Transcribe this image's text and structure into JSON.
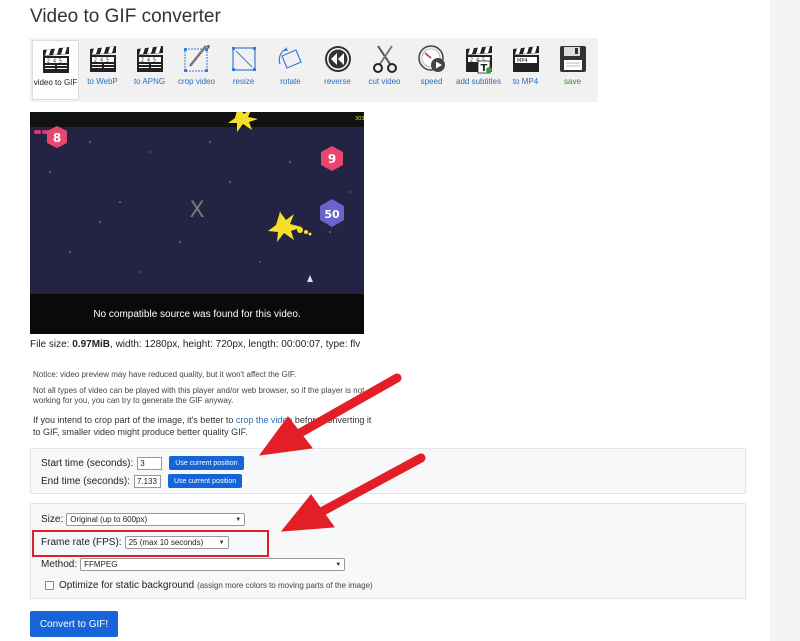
{
  "page": {
    "title": "Video to GIF converter"
  },
  "toolbar": {
    "items": [
      {
        "label": "video to GIF",
        "icon": "clapperboard-icon",
        "active": true
      },
      {
        "label": "to WebP",
        "icon": "clapperboard-icon"
      },
      {
        "label": "to APNG",
        "icon": "clapperboard-icon"
      },
      {
        "label": "crop video",
        "icon": "crop-icon"
      },
      {
        "label": "resize",
        "icon": "resize-icon"
      },
      {
        "label": "rotate",
        "icon": "rotate-icon"
      },
      {
        "label": "reverse",
        "icon": "reverse-icon"
      },
      {
        "label": "cut video",
        "icon": "scissors-icon"
      },
      {
        "label": "speed",
        "icon": "speedometer-icon"
      },
      {
        "label": "add subtitles",
        "icon": "subtitles-icon"
      },
      {
        "label": "to MP4",
        "icon": "mp4-icon"
      },
      {
        "label": "save",
        "icon": "floppy-disk-icon"
      }
    ]
  },
  "video": {
    "message": "No compatible source was found for this video.",
    "close_glyph": "X",
    "game": {
      "badge_8": "8",
      "badge_9": "9",
      "badge_50": "50",
      "score": "303"
    }
  },
  "file_info": {
    "size_label": "File size:",
    "size_value": "0.97MiB",
    "rest": ", width: 1280px, height: 720px, length: 00:00:07, type: flv"
  },
  "notice": {
    "line1": "Notice: video preview may have reduced quality, but it won't affect the GIF.",
    "line2": "Not all types of video can be played with this player and/or web browser, so if the player is not working for you, you can try to generate the GIF anyway.",
    "line3_a": "If you intend to crop part of the image, it's better to ",
    "line3_link": "crop the video",
    "line3_b": " before converting it to GIF, smaller video might produce better quality GIF."
  },
  "time": {
    "start_label": "Start time (seconds):",
    "start_value": "3",
    "end_label": "End time (seconds):",
    "end_value": "7.133",
    "use_current": "Use current position"
  },
  "options": {
    "size_label": "Size:",
    "size_value": "Original (up to 600px)",
    "fps_label": "Frame rate (FPS):",
    "fps_value": "25 (max 10 seconds)",
    "method_label": "Method:",
    "method_value": "FFMPEG",
    "optimize_label": "Optimize for static background",
    "optimize_note": "(assign more colors to moving parts of the image)"
  },
  "convert_button": "Convert to GIF!",
  "colors": {
    "accent_blue": "#1565d8",
    "highlight_red": "#e41e26",
    "arrow_red": "#e41e26"
  }
}
